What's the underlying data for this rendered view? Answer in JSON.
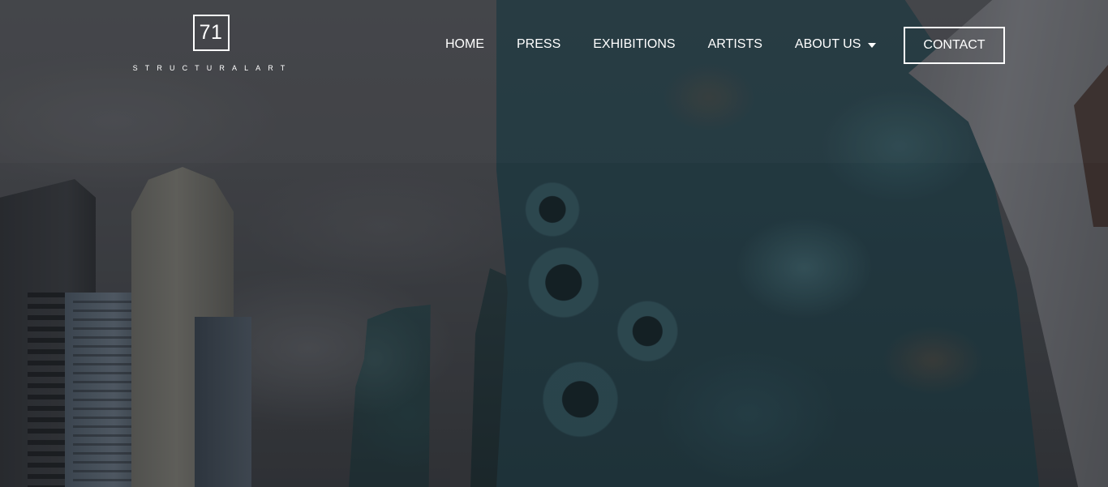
{
  "brand": {
    "logo_number": "71",
    "logo_text": "STRUCTURALART"
  },
  "nav": {
    "items": [
      {
        "label": "HOME"
      },
      {
        "label": "PRESS"
      },
      {
        "label": "EXHIBITIONS"
      },
      {
        "label": "ARTISTS"
      },
      {
        "label": "ABOUT US",
        "has_dropdown": true,
        "icon": "caret-down-icon"
      }
    ],
    "contact_label": "CONTACT"
  },
  "hero": {
    "background": "blurred photo of a large teal sculpture among city buildings under an overcast sky"
  },
  "colors": {
    "nav_text": "#ffffff",
    "contact_border": "#ffffff"
  }
}
